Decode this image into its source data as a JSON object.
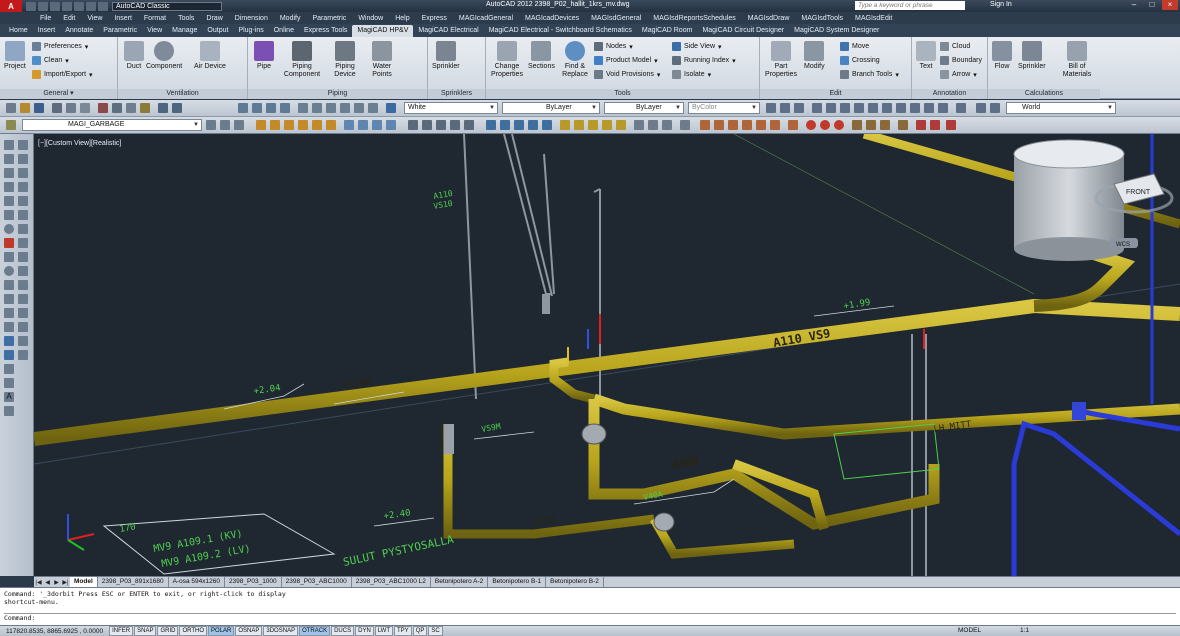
{
  "titlebar": {
    "workspace": "AutoCAD Classic",
    "title": "AutoCAD 2012   2398_P02_hallit_1krs_mv.dwg",
    "search_placeholder": "Type a keyword or phrase",
    "sign_in": "Sign In"
  },
  "menu": [
    "File",
    "Edit",
    "View",
    "Insert",
    "Format",
    "Tools",
    "Draw",
    "Dimension",
    "Modify",
    "Parametric",
    "Window",
    "Help",
    "Express",
    "MAGIcadGeneral",
    "MAGIcadDevices",
    "MAGIsdGeneral",
    "MAGIsdReportsSchedules",
    "MAGIsdDraw",
    "MAGIsdTools",
    "MAGIsdEdit"
  ],
  "ribbon_tabs": [
    "Home",
    "Insert",
    "Annotate",
    "Parametric",
    "View",
    "Manage",
    "Output",
    "Plug-ins",
    "Online",
    "Express Tools",
    "MagiCAD HP&V",
    "MagiCAD Electrical",
    "MagiCAD Electrical - Switchboard Schematics",
    "MagiCAD Room",
    "MagiCAD Circuit Designer",
    "MagiCAD System Designer"
  ],
  "active_tab": "MagiCAD HP&V",
  "ribbon": {
    "general": {
      "title": "General",
      "project": "Project",
      "preferences": "Preferences",
      "clean": "Clean",
      "import_export": "Import/Export"
    },
    "ventilation": {
      "title": "Ventilation",
      "duct": "Duct",
      "component": "Component",
      "air_device": "Air Device"
    },
    "piping": {
      "title": "Piping",
      "pipe": "Pipe",
      "piping_component": "Piping Component",
      "piping_device": "Piping Device",
      "water_points": "Water Points"
    },
    "sprinklers": {
      "title": "Sprinklers",
      "sprinkler": "Sprinkler"
    },
    "tools": {
      "title": "Tools",
      "change_properties": "Change Properties",
      "sections": "Sections",
      "find_replace": "Find & Replace",
      "nodes": "Nodes",
      "product_model": "Product Model",
      "void_provisions": "Void Provisions",
      "side_view": "Side View",
      "running_index": "Running Index",
      "isolate": "Isolate"
    },
    "edit": {
      "title": "Edit",
      "part_properties": "Part Properties",
      "modify": "Modify",
      "move": "Move",
      "crossing": "Crossing",
      "branch_tools": "Branch Tools"
    },
    "annotation": {
      "title": "Annotation",
      "text": "Text",
      "cloud": "Cloud",
      "boundary": "Boundary",
      "arrow": "Arrow"
    },
    "calculations": {
      "title": "Calculations",
      "flow": "Flow",
      "sprinkler": "Sprinkler",
      "bill_of_materials": "Bill of Materials"
    }
  },
  "toolbar": {
    "color": "White",
    "linetype": "ByLayer",
    "lineweight": "ByLayer",
    "plotstyle": "ByColor",
    "ucs": "World",
    "layer": "MAGI_GARBAGE"
  },
  "viewport": {
    "label": "[−][Custom View][Realistic]",
    "viewcube_face": "FRONT",
    "wcs_label": "WCS",
    "annotations": [
      "A110 VS9",
      "A109",
      "+1.99",
      "+2.04",
      "+2.40",
      "V110M",
      "VS9M",
      "V75M",
      "V40A",
      "SULUT PYSTYOSALLA",
      "MV9 A109.1 (KV)",
      "MV9 A109.2 (LV)",
      "LH MITT",
      "170",
      "A110",
      "VS10"
    ]
  },
  "layout_tabs": [
    "Model",
    "2398_P03_891x1680",
    "A-osa 594x1260",
    "2398_P03_1000",
    "2398_P03_ABC1000",
    "2398_P03_ABC1000 L2",
    "Betonipotero A-2",
    "Betonipotero B-1",
    "Betonipotero B-2"
  ],
  "command": {
    "history1": "Command: '_3dorbit Press ESC or ENTER to exit, or right-click to display",
    "history2": "shortcut-menu.",
    "prompt": "Command:"
  },
  "status": {
    "coords": "117820.8535, 8865.6925 , 0.0000",
    "toggles": [
      "INFER",
      "SNAP",
      "GRID",
      "ORTHO",
      "POLAR",
      "OSNAP",
      "3DOSNAP",
      "OTRACK",
      "DUCS",
      "DYN",
      "LWT",
      "TPY",
      "QP",
      "SC"
    ],
    "active_toggles": [
      "POLAR",
      "OTRACK"
    ],
    "space": "MODEL",
    "scale": "1:1"
  },
  "colors": {
    "pipe_yellow": "#b8a51c",
    "viewport_bg": "#1f2731",
    "label_green": "#4fd04f",
    "ribbon_bg": "#dde3ea"
  }
}
